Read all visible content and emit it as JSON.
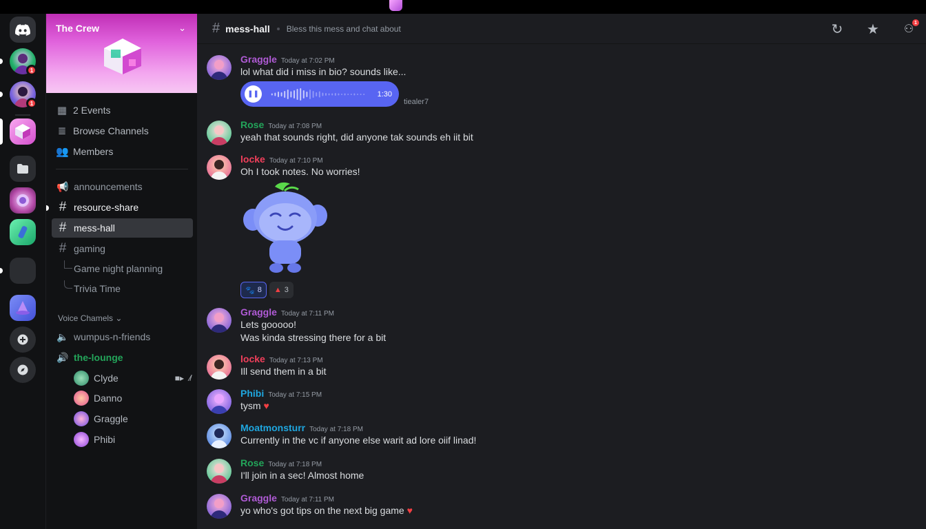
{
  "server": {
    "name": "The Crew",
    "sidebar_nav": [
      {
        "icon": "calendar-icon",
        "label": "2 Events"
      },
      {
        "icon": "browse-channels-icon",
        "label": "Browse Channels"
      },
      {
        "icon": "members-icon",
        "label": "Members"
      }
    ],
    "channels": [
      {
        "name": "announcements",
        "type": "announcement"
      },
      {
        "name": "resource-share",
        "type": "text",
        "unread": true
      },
      {
        "name": "mess-hall",
        "type": "text",
        "selected": true
      },
      {
        "name": "gaming",
        "type": "text"
      }
    ],
    "threads": [
      "Game night planning",
      "Trivia Time"
    ],
    "voice_category": "Voice Chamels",
    "voice_channels": [
      {
        "name": "wumpus-n-friends",
        "live": false
      },
      {
        "name": "the-lounge",
        "live": true
      }
    ],
    "voice_users": [
      "Clyde",
      "Danno",
      "Graggle",
      "Phibi"
    ]
  },
  "rail": {
    "badges": [
      "1",
      "1"
    ]
  },
  "channel_header": {
    "name": "mess-hall",
    "topic": "Bless this mess and chat about",
    "notification_count": "1"
  },
  "colors": {
    "accent": "#5865f2",
    "graggle": "#b05bd6",
    "rose": "#23a55a",
    "locke": "#f23f5b",
    "phibi": "#1fa7e0",
    "moatmonsturr": "#1fa7e0",
    "online": "#23a55a"
  },
  "messages": [
    {
      "user": "Graggle",
      "time": "Today at 7:02 PM",
      "text": "lol what did i miss in bio? sounds like...",
      "voice_duration": "1:30",
      "side_note": "tiealer7"
    },
    {
      "user": "Rose",
      "time": "Today at 7:08 PM",
      "text": "yeah that sounds right, did anyone tak sounds eh iit bit"
    },
    {
      "user": "locke",
      "time": "Today at 7:10 PM",
      "text": "Oh I took notes. No worries!",
      "reactions": [
        {
          "icon": "wumpus-icon",
          "count": "8"
        },
        {
          "icon": "hat-icon",
          "count": "3"
        }
      ]
    },
    {
      "user": "Graggle",
      "time": "Today at 7:11 PM",
      "text": "Lets gooooo!",
      "text2": "Was kinda stressing there for a bit"
    },
    {
      "user": "locke",
      "time": "Today at 7:13 PM",
      "text": "Ill send them in a bit"
    },
    {
      "user": "Phibi",
      "time": "Today at 7:15 PM",
      "text": "tysm"
    },
    {
      "user": "Moatmonsturr",
      "time": "Today at 7:18 PM",
      "text": "Currently in the vc if anyone else warit ad lore oiif linad!"
    },
    {
      "user": "Rose",
      "time": "Today at 7:18 PM",
      "text": "I'll join in a sec! Almost home"
    },
    {
      "user": "Graggle",
      "time": "Today at 7:11 PM",
      "text": "yo who's got tips on the next big game"
    }
  ]
}
